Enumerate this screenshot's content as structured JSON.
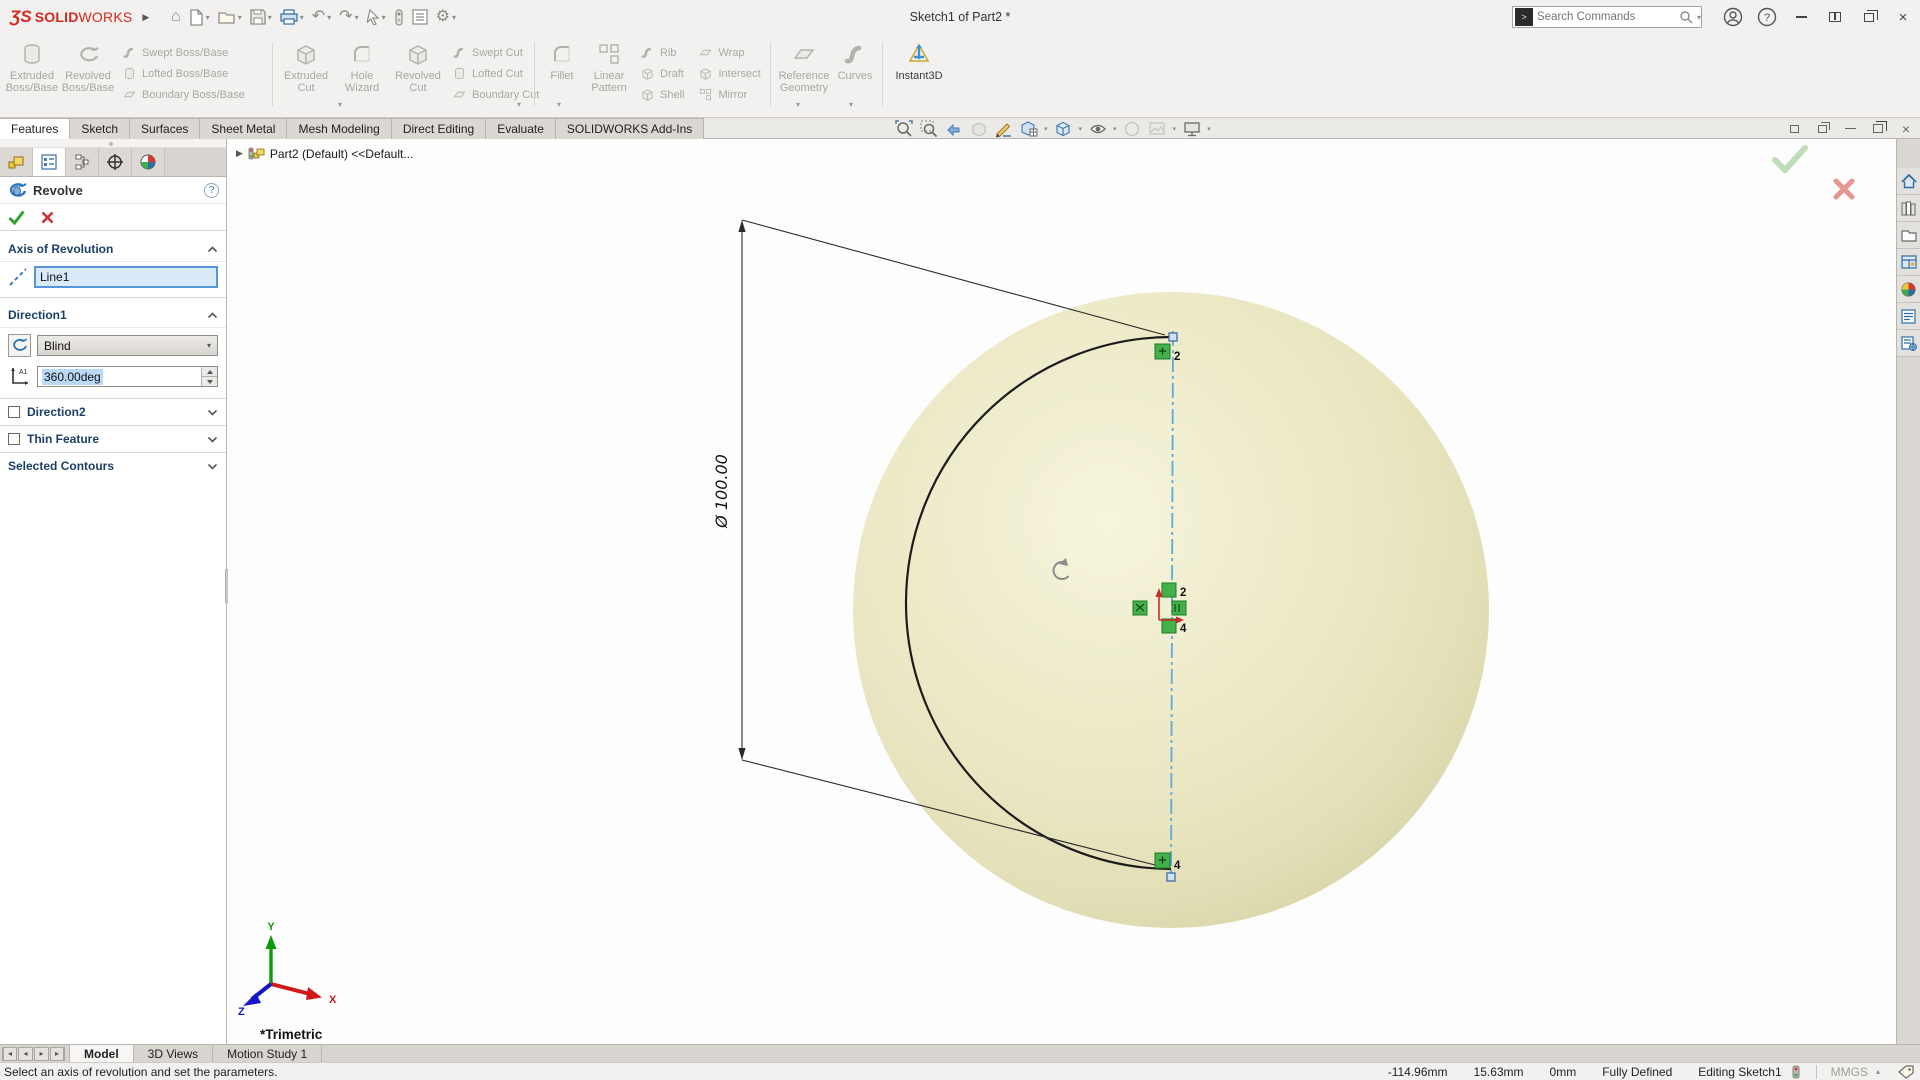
{
  "glyphs": {
    "dropdown": "▾",
    "play": "▶",
    "minimize": "–",
    "close": "×",
    "left": "◂",
    "right": "▸",
    "units_caret": "▴",
    "help": "?",
    "search_prompt": ">"
  },
  "titlebar": {
    "logo_mark": "ƷS",
    "brand_bold": "SOLID",
    "brand_light": "WORKS",
    "doc_title": "Sketch1 of Part2 *",
    "search_placeholder": "Search Commands"
  },
  "ribbon": {
    "groups": [
      {
        "big": [
          {
            "l1": "Extruded",
            "l2": "Boss/Base"
          },
          {
            "l1": "Revolved",
            "l2": "Boss/Base"
          }
        ],
        "small": [
          "Swept Boss/Base",
          "Lofted Boss/Base",
          "Boundary Boss/Base"
        ]
      },
      {
        "big": [
          {
            "l1": "Extruded",
            "l2": "Cut"
          },
          {
            "l1": "Hole",
            "l2": "Wizard"
          },
          {
            "l1": "Revolved",
            "l2": "Cut"
          }
        ],
        "small": [
          "Swept Cut",
          "Lofted Cut",
          "Boundary Cut"
        ]
      },
      {
        "big": [
          {
            "l1": "Fillet",
            "l2": ""
          },
          {
            "l1": "Linear",
            "l2": "Pattern"
          }
        ],
        "smallA": [
          "Rib",
          "Draft",
          "Shell"
        ],
        "smallB": [
          "Wrap",
          "Intersect",
          "Mirror"
        ]
      },
      {
        "big": [
          {
            "l1": "Reference",
            "l2": "Geometry"
          },
          {
            "l1": "Curves",
            "l2": ""
          }
        ]
      },
      {
        "big": [
          {
            "l1": "Instant3D",
            "l2": ""
          }
        ]
      }
    ]
  },
  "command_tabs": {
    "items": [
      "Features",
      "Sketch",
      "Surfaces",
      "Sheet Metal",
      "Mesh Modeling",
      "Direct Editing",
      "Evaluate",
      "SOLIDWORKS Add-Ins"
    ],
    "active": "Features"
  },
  "headsup_icons": [
    "zoom-to-fit",
    "zoom-to-area",
    "previous-view",
    "section-view",
    "sketch-visibility",
    "edit-appearance",
    "view-orientation",
    "hide-show-items",
    "appearances",
    "scene",
    "view-settings"
  ],
  "property_manager": {
    "title": "Revolve",
    "axis_section": {
      "label": "Axis of Revolution",
      "value": "Line1"
    },
    "direction1": {
      "label": "Direction1",
      "end_condition": "Blind",
      "angle": "360.00deg"
    },
    "direction2": {
      "label": "Direction2"
    },
    "thin_feature": {
      "label": "Thin Feature"
    },
    "selected_contours": {
      "label": "Selected Contours"
    }
  },
  "viewport": {
    "breadcrumb": "Part2 (Default) <<Default...",
    "dimension": "Ø 100.00",
    "orientation": "*Trimetric",
    "axis_labels": {
      "x": "X",
      "y": "Y",
      "z": "Z"
    },
    "point_labels": {
      "top": "2",
      "center_top": "2",
      "center_bottom": "4",
      "bottom": "4"
    }
  },
  "task_pane_icons": [
    "home",
    "solidworks-resources",
    "file-explorer",
    "design-library",
    "appearances-scenes",
    "view-palette",
    "custom-properties"
  ],
  "doc_tabs": {
    "items": [
      "Model",
      "3D Views",
      "Motion Study 1"
    ],
    "active": "Model"
  },
  "status_bar": {
    "message": "Select an axis of revolution and set the parameters.",
    "coord_x": "-114.96mm",
    "coord_y": "15.63mm",
    "coord_z": "0mm",
    "constraint_state": "Fully Defined",
    "mode": "Editing Sketch1",
    "units": "MMGS"
  },
  "colors": {
    "brand_red": "#d6281e",
    "accent_blue": "#2f7bc1",
    "sphere_fill": "#ebe8c6",
    "sketch_marker_green": "#3fae4a",
    "centerline_blue": "#5fa8dc",
    "selection_blue": "#b9d9f7"
  }
}
